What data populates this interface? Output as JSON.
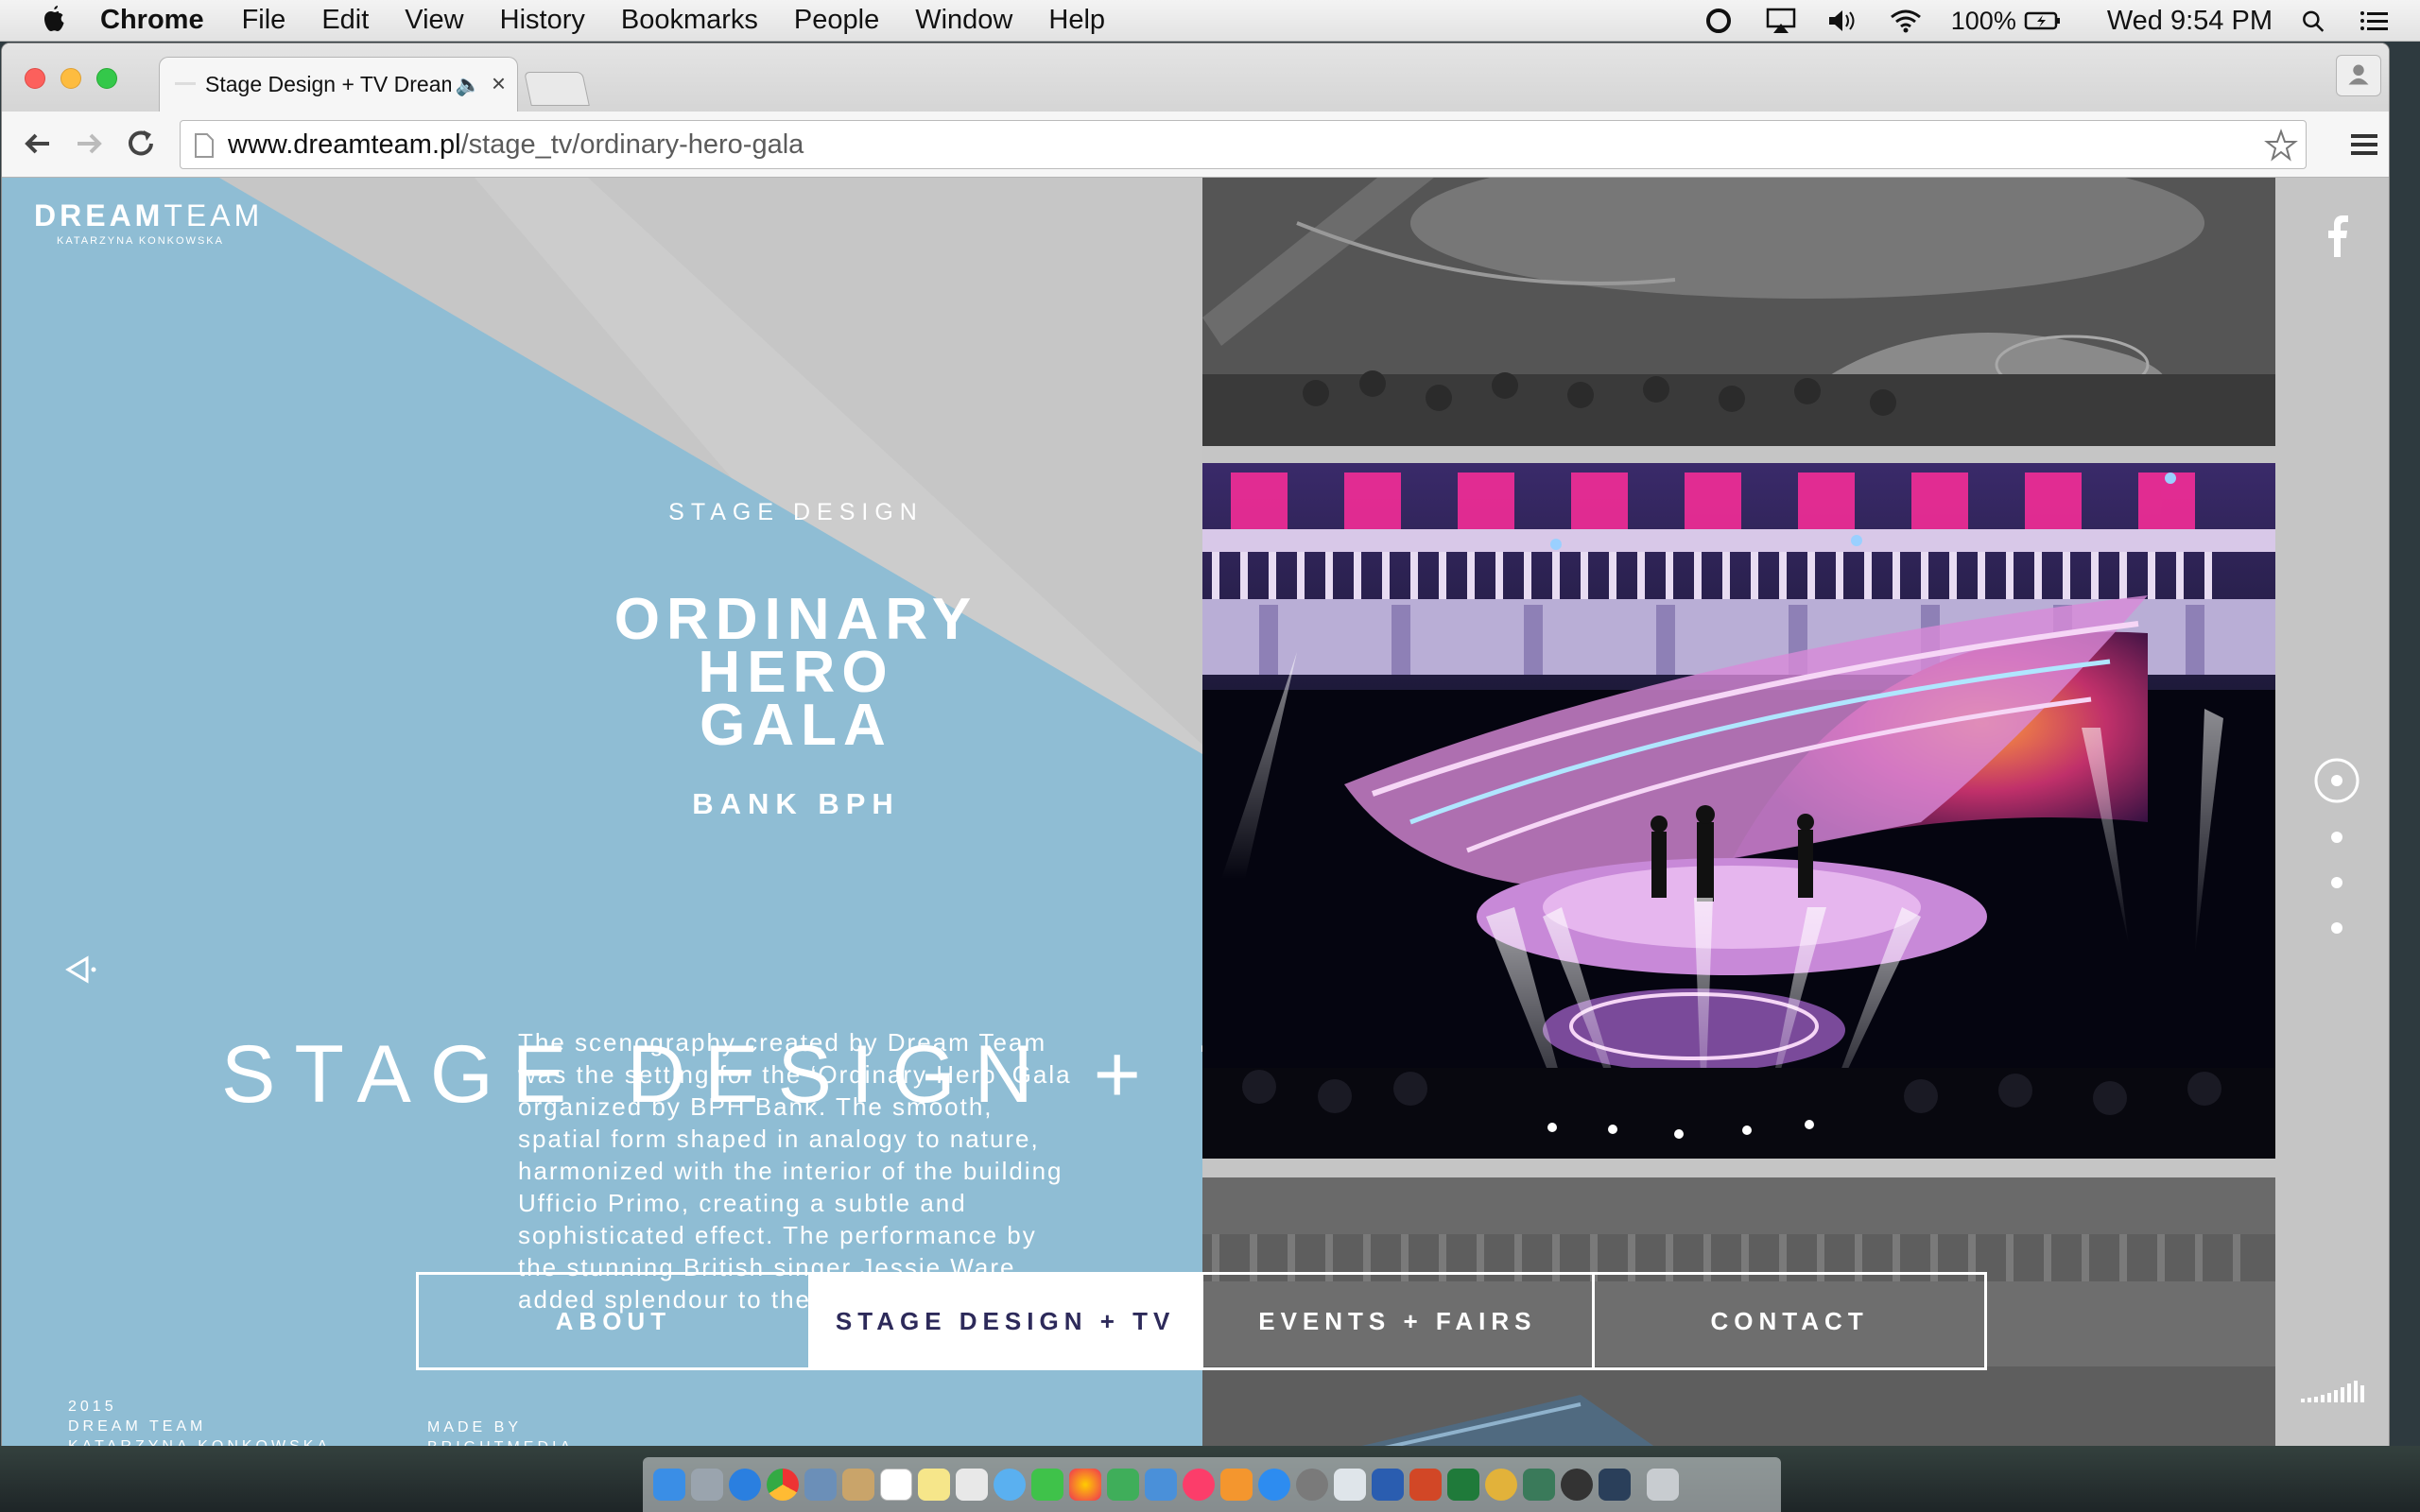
{
  "menubar": {
    "app": "Chrome",
    "items": [
      "File",
      "Edit",
      "View",
      "History",
      "Bookmarks",
      "People",
      "Window",
      "Help"
    ],
    "battery": "100%",
    "clock": "Wed 9:54 PM"
  },
  "browser": {
    "tab_title": "Stage Design + TV Dream",
    "url_host": "www.dreamteam.pl",
    "url_path": "/stage_tv/ordinary-hero-gala"
  },
  "page": {
    "logo_bold": "DREAM",
    "logo_light": "TEAM",
    "logo_sub": "KATARZYNA KONKOWSKA",
    "eyebrow": "STAGE DESIGN",
    "title": "ORDINARY\nHERO\nGALA",
    "client": "BANK BPH",
    "category_big": "STAGE DESIGN + TV",
    "description": "The scenography created by Dream Team was the setting for the ‘Ordinary Hero’ Gala organized by BPH Bank. The smooth, spatial form shaped in analogy to nature, harmonized with the interior of the building Ufficio Primo, creating a subtle and sophisticated effect. The performance by the stunning British singer Jessie Ware added splendour to the event.",
    "footer_year": "2015",
    "footer_line2": "DREAM TEAM",
    "footer_line3": "KATARZYNA KONKOWSKA",
    "made_by_1": "MADE BY",
    "made_by_2": "BRIGHTMEDIA",
    "nav": [
      "ABOUT",
      "STAGE DESIGN + TV",
      "EVENTS + FAIRS",
      "CONTACT"
    ],
    "active_nav": "STAGE DESIGN + TV",
    "slide_count": 4,
    "active_slide": 1
  },
  "colors": {
    "accent_blue": "#8fbdd4",
    "panel_grey": "#c6c6c6",
    "nav_active_text": "#2d2a5a"
  }
}
